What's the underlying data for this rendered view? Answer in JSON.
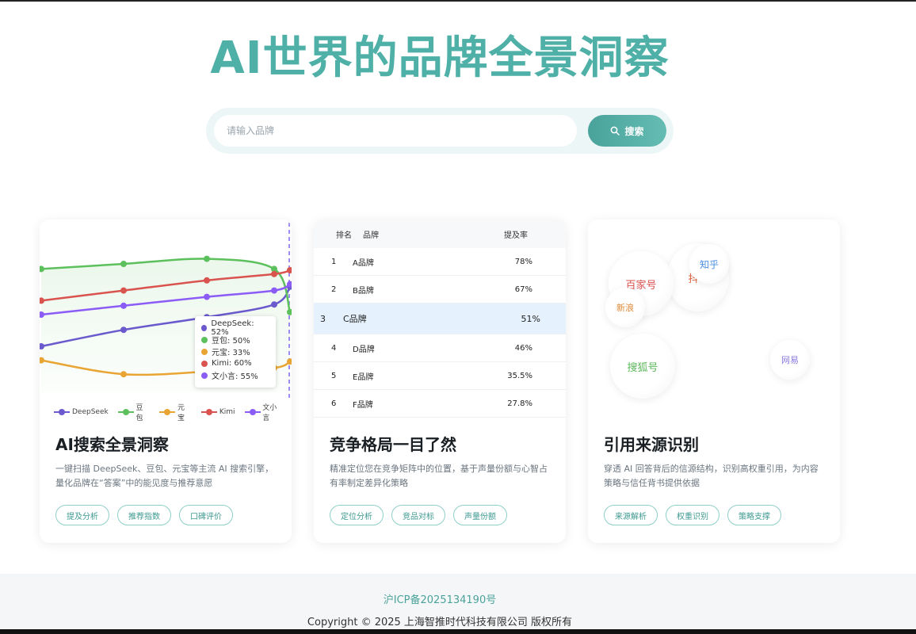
{
  "header": {
    "title": "AI世界的品牌全景洞察"
  },
  "search": {
    "placeholder": "请输入品牌",
    "button_label": "搜索",
    "button_icon": "search-icon"
  },
  "colors": {
    "accent": "#4fb0a7",
    "deepseek": "#6a5acd",
    "doubao": "#5cc05c",
    "yuanbao": "#e8a534",
    "kimi": "#d9534f",
    "wenxiaoyan": "#8b5cf6"
  },
  "cards": [
    {
      "title": "AI搜索全景洞察",
      "description": "一键扫描 DeepSeek、豆包、元宝等主流 AI 搜索引擎，量化品牌在“答案”中的能见度与推荐意愿",
      "tags": [
        "提及分析",
        "推荐指数",
        "口碑评价"
      ]
    },
    {
      "title": "竞争格局一目了然",
      "description": "精准定位您在竞争矩阵中的位置，基于声量份额与心智占有率制定差异化策略",
      "tags": [
        "定位分析",
        "竞品对标",
        "声量份额"
      ]
    },
    {
      "title": "引用来源识别",
      "description": "穿透 AI 回答背后的信源结构，识别高权重引用，为内容策略与信任背书提供依据",
      "tags": [
        "来源解析",
        "权重识别",
        "策略支撑"
      ]
    }
  ],
  "chart_data": {
    "type": "line",
    "x": [
      0,
      1,
      2,
      3,
      4
    ],
    "series": [
      {
        "name": "DeepSeek",
        "values": [
          25,
          38,
          48,
          58,
          72
        ]
      },
      {
        "name": "豆包",
        "values": [
          86,
          90,
          94,
          86,
          52
        ]
      },
      {
        "name": "元宝",
        "values": [
          14,
          3,
          5,
          8,
          13
        ]
      },
      {
        "name": "Kimi",
        "values": [
          61,
          69,
          77,
          82,
          85
        ]
      },
      {
        "name": "文小言",
        "values": [
          50,
          57,
          64,
          69,
          74
        ]
      }
    ],
    "ylim": [
      0,
      100
    ],
    "tooltip": [
      "DeepSeek: 52%",
      "豆包: 50%",
      "元宝: 33%",
      "Kimi: 60%",
      "文小言: 55%"
    ],
    "legend_position": "bottom",
    "grid": false
  },
  "ranking": {
    "headers": {
      "rank": "排名",
      "brand": "品牌",
      "rate": "提及率"
    },
    "rows": [
      {
        "rank": "1",
        "brand": "A品牌",
        "rate": "78%"
      },
      {
        "rank": "2",
        "brand": "B品牌",
        "rate": "67%"
      },
      {
        "rank": "3",
        "brand": "C品牌",
        "rate": "51%"
      },
      {
        "rank": "4",
        "brand": "D品牌",
        "rate": "46%"
      },
      {
        "rank": "5",
        "brand": "E品牌",
        "rate": "35.5%"
      },
      {
        "rank": "6",
        "brand": "F品牌",
        "rate": "27.8%"
      }
    ]
  },
  "sources": {
    "bubbles": [
      {
        "label": "百家号",
        "color": "#d9534f"
      },
      {
        "label": "抖",
        "color": "#e0603a"
      },
      {
        "label": "知乎",
        "color": "#4a90e2"
      },
      {
        "label": "新浪",
        "color": "#e08a3a"
      },
      {
        "label": "搜狐号",
        "color": "#5cb85c"
      },
      {
        "label": "网易",
        "color": "#8b7be0"
      }
    ]
  },
  "footer": {
    "icp": "沪ICP备2025134190号",
    "copyright": "Copyright © 2025 上海智推时代科技有限公司 版权所有"
  }
}
